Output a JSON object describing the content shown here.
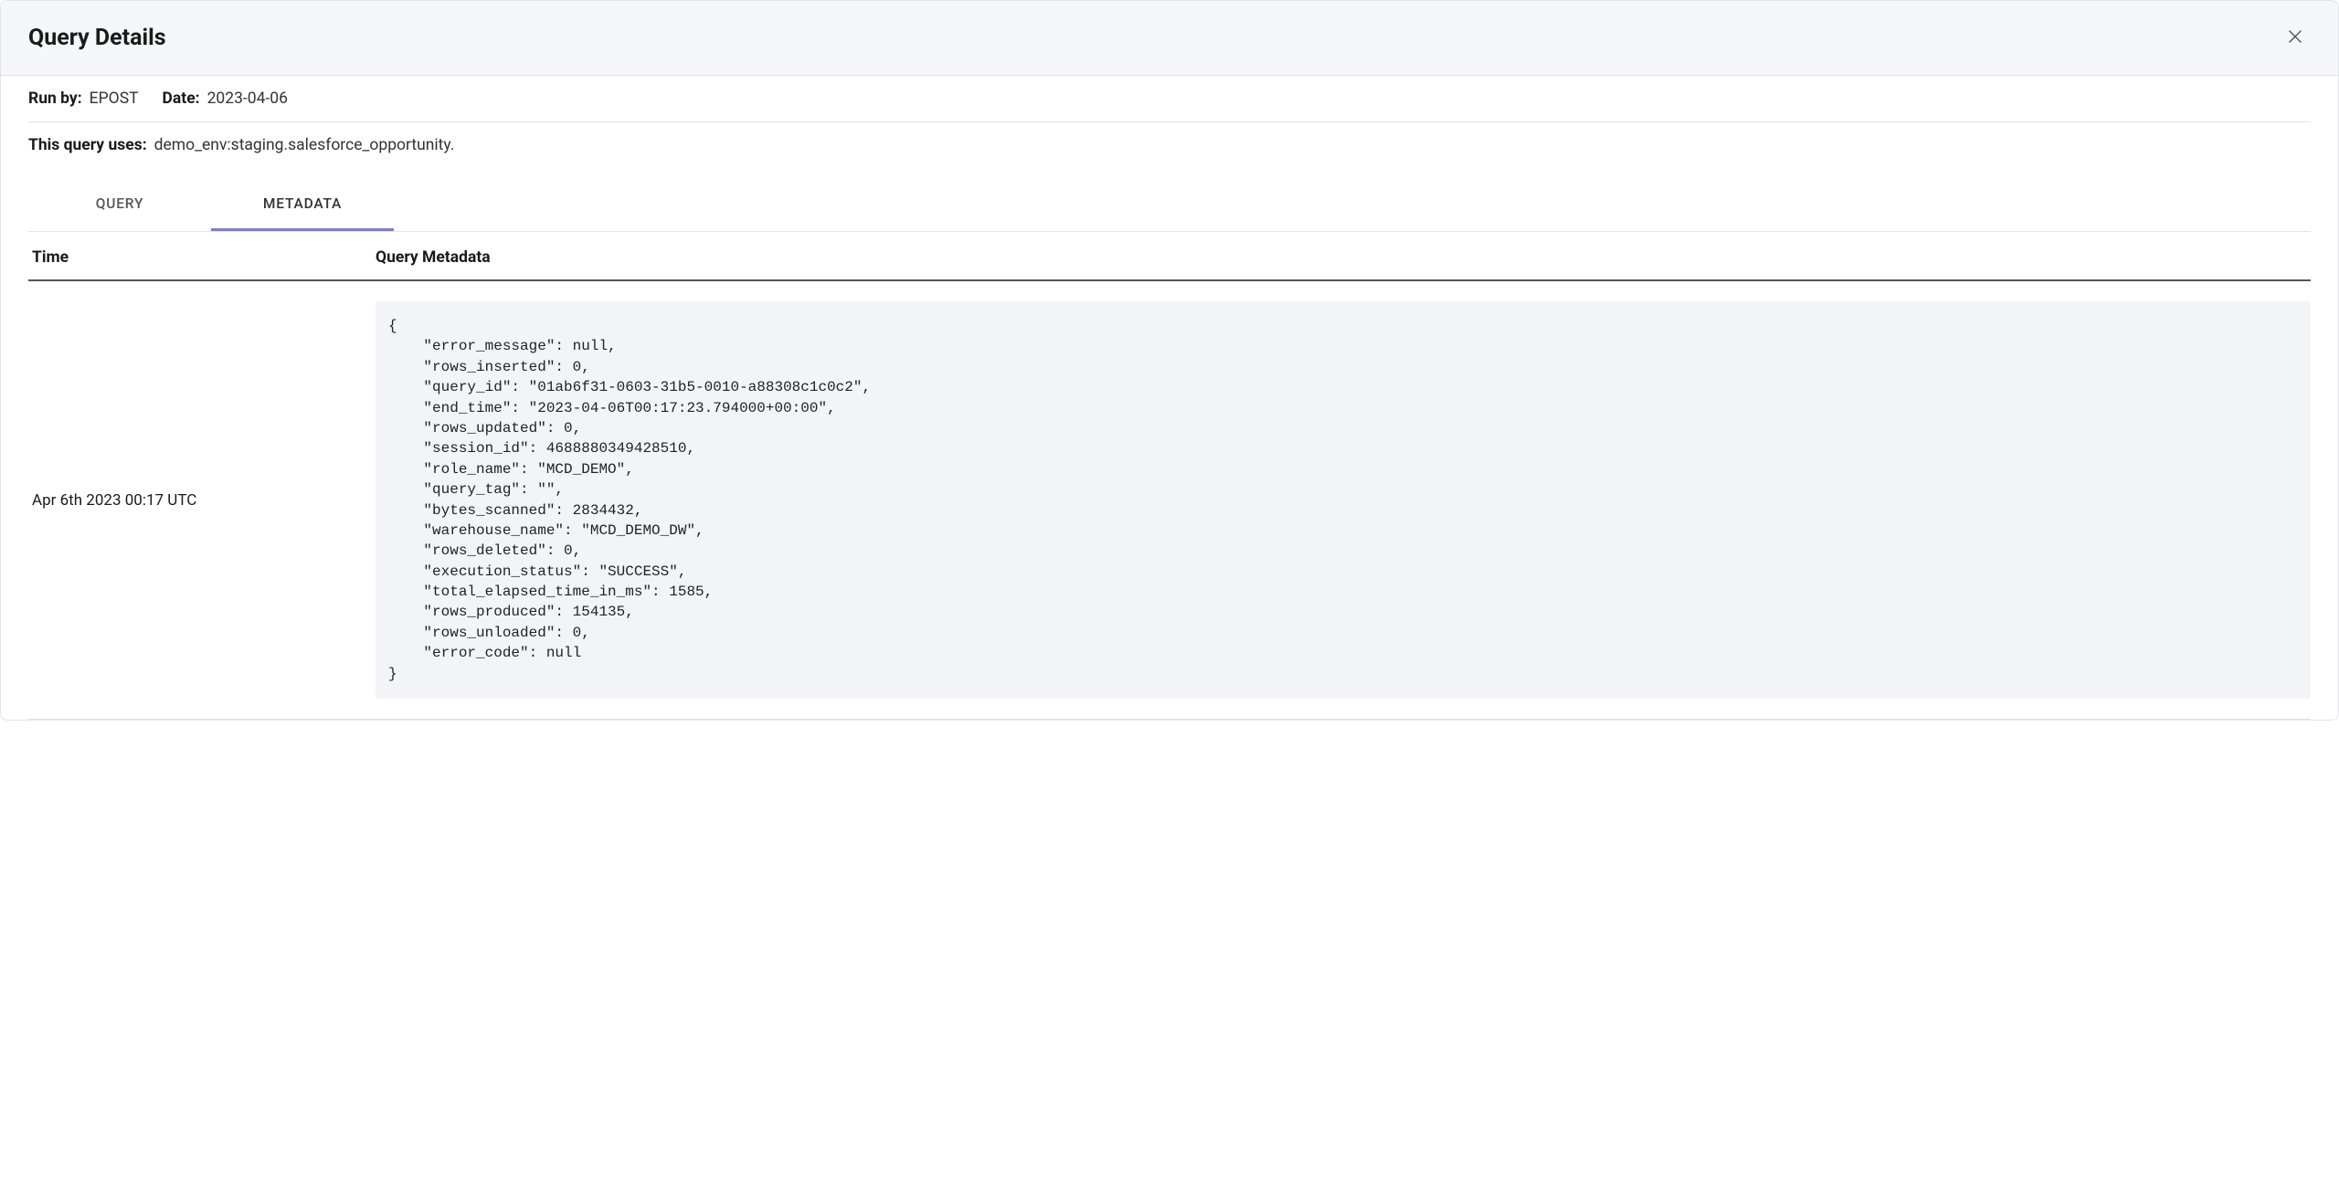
{
  "header": {
    "title": "Query Details"
  },
  "info": {
    "run_by_label": "Run by:",
    "run_by_value": "EPOST",
    "date_label": "Date:",
    "date_value": "2023-04-06",
    "uses_label": "This query uses:",
    "uses_value": "demo_env:staging.salesforce_opportunity."
  },
  "tabs": {
    "query": "QUERY",
    "metadata": "METADATA"
  },
  "columns": {
    "time": "Time",
    "metadata": "Query Metadata"
  },
  "row": {
    "time": "Apr 6th 2023 00:17 UTC",
    "metadata": {
      "error_message": null,
      "rows_inserted": 0,
      "query_id": "01ab6f31-0603-31b5-0010-a88308c1c0c2",
      "end_time": "2023-04-06T00:17:23.794000+00:00",
      "rows_updated": 0,
      "session_id": 4688880349428510,
      "role_name": "MCD_DEMO",
      "query_tag": "",
      "bytes_scanned": 2834432,
      "warehouse_name": "MCD_DEMO_DW",
      "rows_deleted": 0,
      "execution_status": "SUCCESS",
      "total_elapsed_time_in_ms": 1585,
      "rows_produced": 154135,
      "rows_unloaded": 0,
      "error_code": null
    }
  }
}
